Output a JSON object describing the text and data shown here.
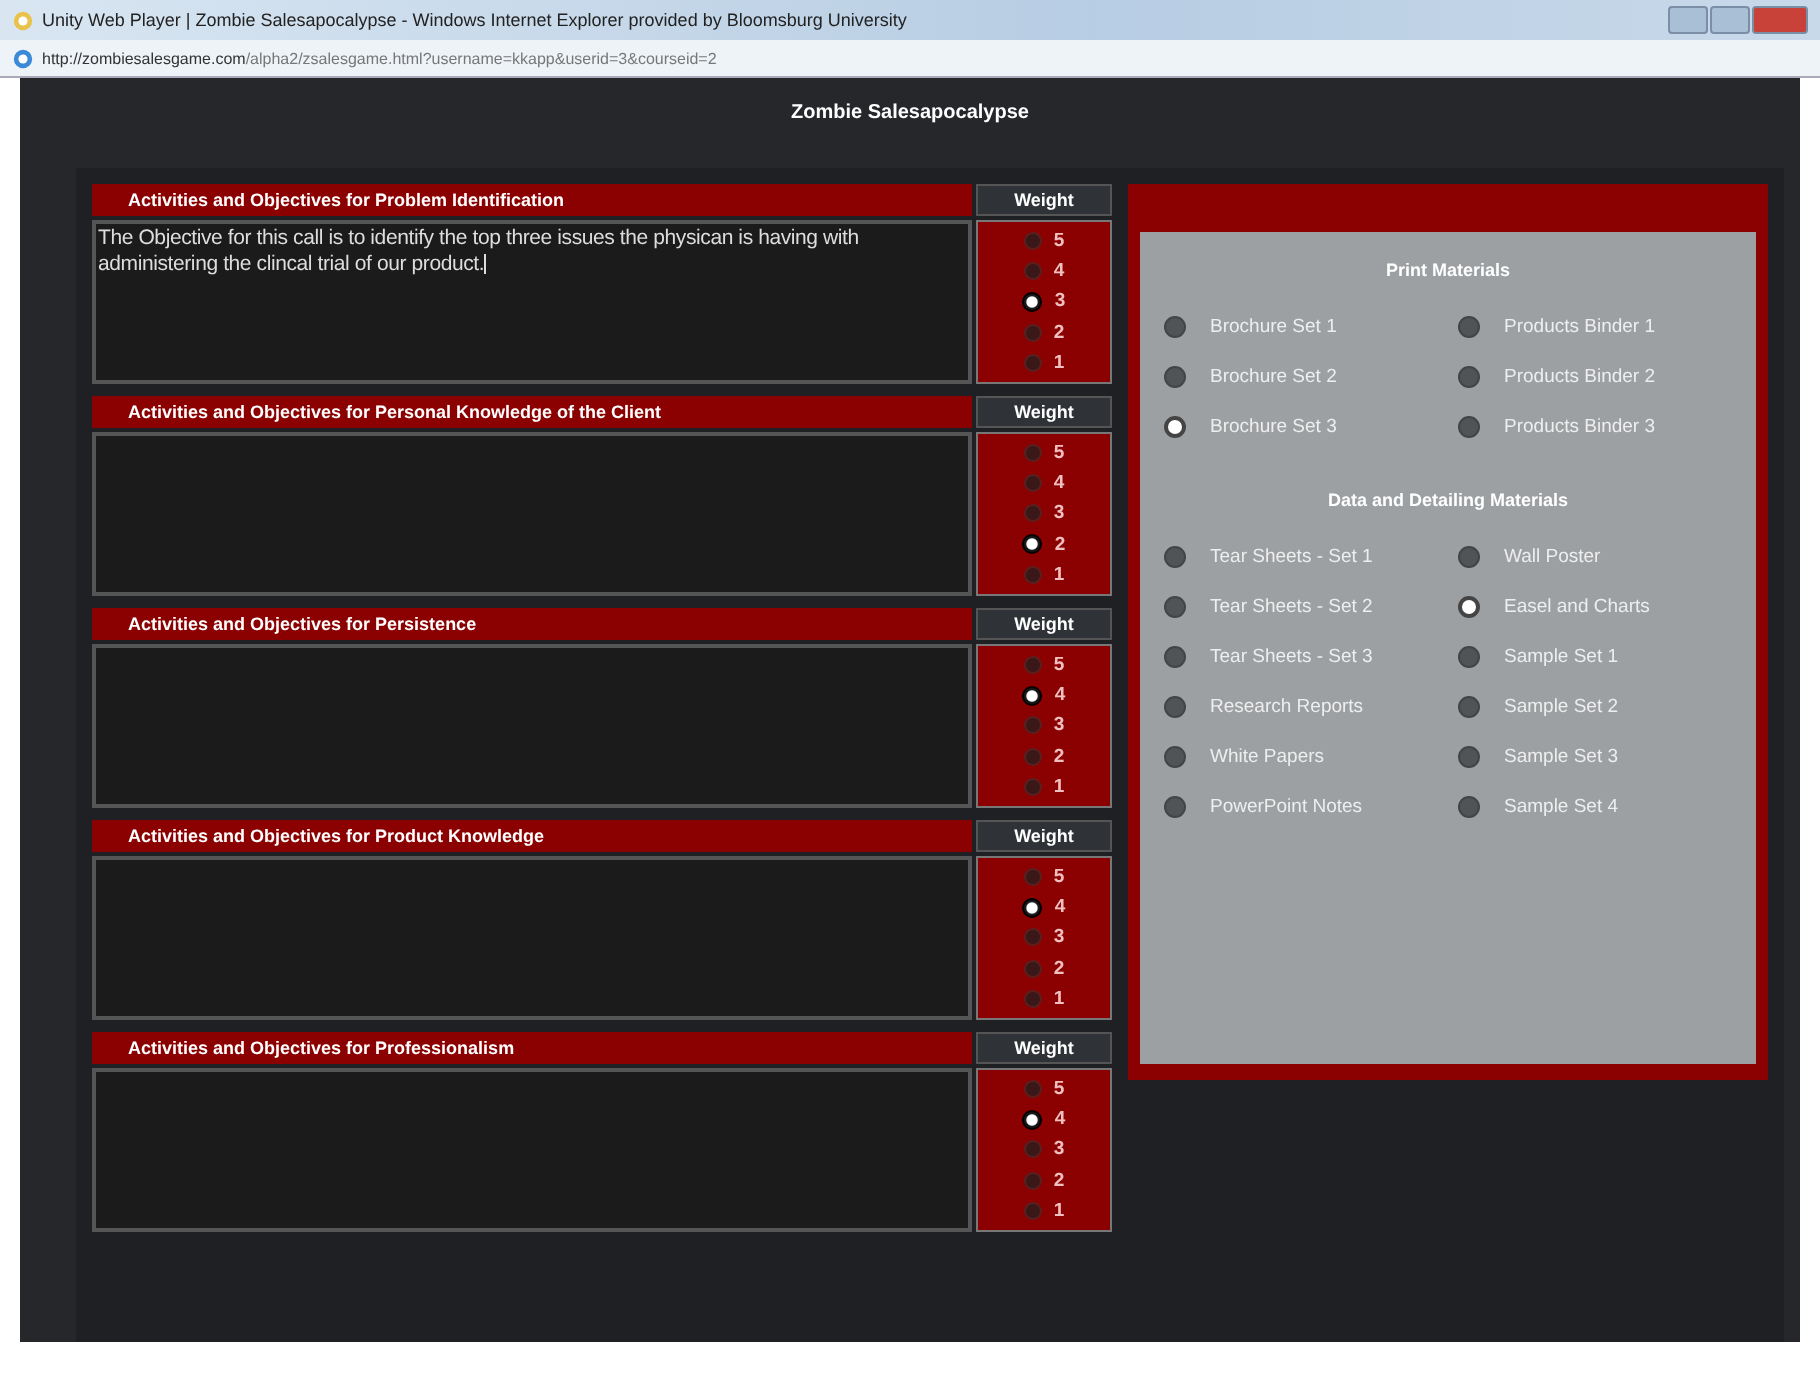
{
  "window": {
    "title": "Unity Web Player | Zombie Salesapocalypse - Windows Internet Explorer provided by Bloomsburg University"
  },
  "address_bar": {
    "host": "http://zombiesalesgame.com",
    "path": "/alpha2/zsalesgame.html?username=kkapp&userid=3&courseid=2"
  },
  "app": {
    "title": "Zombie Salesapocalypse"
  },
  "sections": [
    {
      "heading": "Activities and Objectives for Problem Identification",
      "value": "The Objective for this call is to identify the top three issues the physican is having with administering the clincal trial of our product.",
      "weight_label": "Weight",
      "weights": [
        {
          "label": "5",
          "selected": false
        },
        {
          "label": "4",
          "selected": false
        },
        {
          "label": "3",
          "selected": true
        },
        {
          "label": "2",
          "selected": false
        },
        {
          "label": "1",
          "selected": false
        }
      ]
    },
    {
      "heading": "Activities and Objectives for Personal Knowledge of the Client",
      "weight_label": "Weight",
      "weights": [
        {
          "label": "5",
          "selected": false
        },
        {
          "label": "4",
          "selected": false
        },
        {
          "label": "3",
          "selected": false
        },
        {
          "label": "2",
          "selected": true
        },
        {
          "label": "1",
          "selected": false
        }
      ]
    },
    {
      "heading": "Activities and Objectives for Persistence",
      "weight_label": "Weight",
      "weights": [
        {
          "label": "5",
          "selected": false
        },
        {
          "label": "4",
          "selected": true
        },
        {
          "label": "3",
          "selected": false
        },
        {
          "label": "2",
          "selected": false
        },
        {
          "label": "1",
          "selected": false
        }
      ]
    },
    {
      "heading": "Activities and Objectives for Product Knowledge",
      "weight_label": "Weight",
      "weights": [
        {
          "label": "5",
          "selected": false
        },
        {
          "label": "4",
          "selected": true
        },
        {
          "label": "3",
          "selected": false
        },
        {
          "label": "2",
          "selected": false
        },
        {
          "label": "1",
          "selected": false
        }
      ]
    },
    {
      "heading": "Activities and Objectives for Professionalism",
      "weight_label": "Weight",
      "weights": [
        {
          "label": "5",
          "selected": false
        },
        {
          "label": "4",
          "selected": true
        },
        {
          "label": "3",
          "selected": false
        },
        {
          "label": "2",
          "selected": false
        },
        {
          "label": "1",
          "selected": false
        }
      ]
    }
  ],
  "materials": [
    {
      "heading": "Print Materials",
      "items": [
        {
          "label": "Brochure Set 1",
          "selected": false
        },
        {
          "label": "Products Binder 1",
          "selected": false
        },
        {
          "label": "Brochure Set 2",
          "selected": false
        },
        {
          "label": "Products Binder 2",
          "selected": false
        },
        {
          "label": "Brochure Set 3",
          "selected": true
        },
        {
          "label": "Products Binder 3",
          "selected": false
        }
      ]
    },
    {
      "heading": "Data and Detailing Materials",
      "items": [
        {
          "label": "Tear Sheets - Set 1",
          "selected": false
        },
        {
          "label": "Wall Poster",
          "selected": false
        },
        {
          "label": "Tear Sheets - Set 2",
          "selected": false
        },
        {
          "label": "Easel and Charts",
          "selected": true
        },
        {
          "label": "Tear Sheets - Set 3",
          "selected": false
        },
        {
          "label": "Sample Set 1",
          "selected": false
        },
        {
          "label": "Research Reports",
          "selected": false
        },
        {
          "label": "Sample Set 2",
          "selected": false
        },
        {
          "label": "White Papers",
          "selected": false
        },
        {
          "label": "Sample Set 3",
          "selected": false
        },
        {
          "label": "PowerPoint Notes",
          "selected": false
        },
        {
          "label": "Sample Set 4",
          "selected": false
        }
      ]
    }
  ]
}
